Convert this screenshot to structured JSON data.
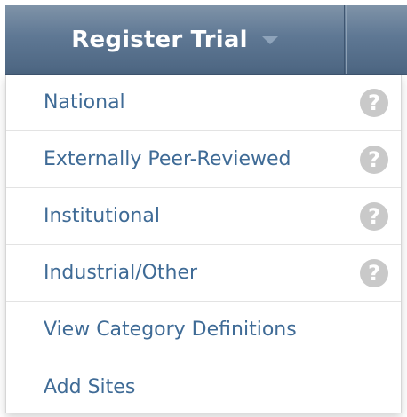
{
  "nav": {
    "register_label": "Register Trial"
  },
  "icons": {
    "caret": "chevron-down-icon",
    "help": "help-circle-icon",
    "help_glyph": "?"
  },
  "colors": {
    "nav_bg": "#5f7894",
    "link": "#3f6b96",
    "help_icon": "#c9c9c9"
  },
  "menu": {
    "items": [
      {
        "label": "National",
        "has_help": true
      },
      {
        "label": "Externally Peer-Reviewed",
        "has_help": true
      },
      {
        "label": "Institutional",
        "has_help": true
      },
      {
        "label": "Industrial/Other",
        "has_help": true
      },
      {
        "label": "View Category Definitions",
        "has_help": false
      },
      {
        "label": "Add Sites",
        "has_help": false
      }
    ]
  }
}
